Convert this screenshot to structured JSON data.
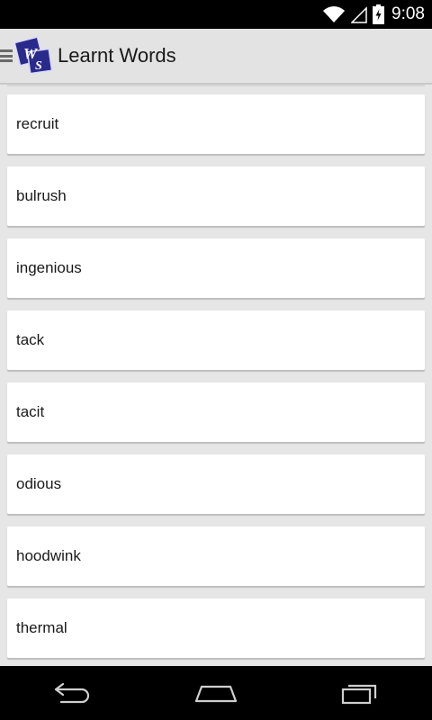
{
  "status_bar": {
    "time": "9:08",
    "icons": [
      "wifi-icon",
      "cell-signal-icon",
      "battery-charging-icon"
    ]
  },
  "action_bar": {
    "title": "Learnt Words",
    "drawer_icon": "hamburger-icon",
    "logo_letters": [
      "W",
      "S"
    ]
  },
  "words": [
    {
      "label": "recruit"
    },
    {
      "label": "bulrush"
    },
    {
      "label": "ingenious"
    },
    {
      "label": "tack"
    },
    {
      "label": "tacit"
    },
    {
      "label": "odious"
    },
    {
      "label": "hoodwink"
    },
    {
      "label": "thermal"
    }
  ],
  "nav_bar": {
    "buttons": [
      "back-icon",
      "home-icon",
      "recents-icon"
    ]
  },
  "colors": {
    "logo_blue": "#2a2a8c",
    "background": "#e6e6e6",
    "card": "#ffffff"
  }
}
